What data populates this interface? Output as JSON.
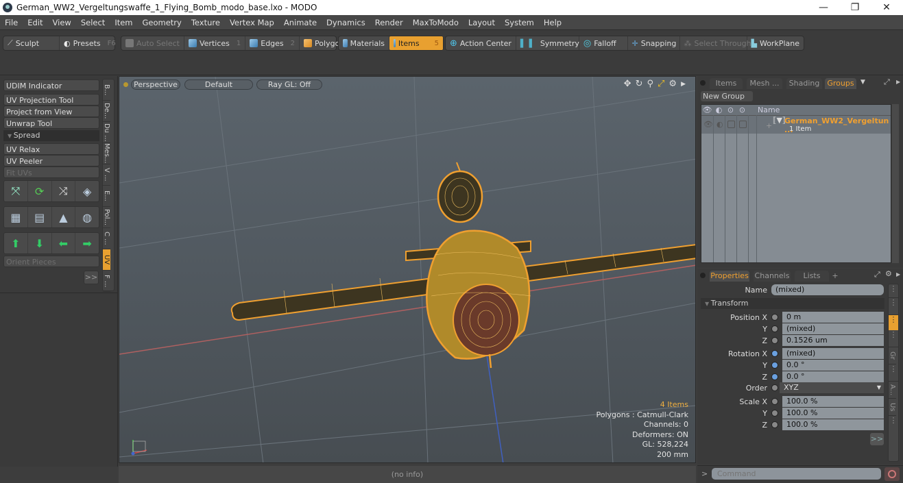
{
  "window": {
    "title": "German_WW2_Vergeltungswaffe_1_Flying_Bomb_modo_base.lxo - MODO",
    "minimize": "—",
    "restore": "❐",
    "close": "✕"
  },
  "menu": [
    "File",
    "Edit",
    "View",
    "Select",
    "Item",
    "Geometry",
    "Texture",
    "Vertex Map",
    "Animate",
    "Dynamics",
    "Render",
    "MaxToModo",
    "Layout",
    "System",
    "Help"
  ],
  "toolbar": {
    "sculpt": "Sculpt",
    "presets": "Presets",
    "presets_key": "F6",
    "auto_select": "Auto Select",
    "vertices": "Vertices",
    "vertices_key": "1",
    "edges": "Edges",
    "edges_key": "2",
    "polygons": "Polygons",
    "materials": "Materials",
    "items": "Items",
    "items_key": "5",
    "action_center": "Action Center",
    "symmetry": "Symmetry",
    "falloff": "Falloff",
    "snapping": "Snapping",
    "select_through": "Select Through",
    "workplane": "WorkPlane"
  },
  "left_panel": {
    "udim": "UDIM Indicator",
    "uv_projection": "UV Projection Tool",
    "project_from_view": "Project from View",
    "unwrap": "Unwrap Tool",
    "spread": "Spread",
    "uv_relax": "UV Relax",
    "uv_peeler": "UV Peeler",
    "fit_uvs": "Fit UVs",
    "orient_pieces": "Orient Pieces",
    "more": ">>",
    "vtabs": [
      "B...",
      "De...",
      "Du ...",
      "Mes...",
      "V ...",
      "E...",
      "Pol...",
      "C ...",
      "UV",
      "F ..."
    ]
  },
  "viewport": {
    "view": "Perspective",
    "shading": "Default",
    "raygl": "Ray GL: Off",
    "hud": {
      "items": "4 Items",
      "polygons": "Polygons : Catmull-Clark",
      "channels": "Channels: 0",
      "deformers": "Deformers: ON",
      "gl": "GL: 528,224",
      "scale": "200 mm"
    },
    "colors": {
      "wire": "#f0a030",
      "axis_x": "#c05050",
      "axis_z": "#4060c0"
    }
  },
  "status": "(no info)",
  "groups_panel": {
    "tabs": [
      "Items",
      "Mesh ...",
      "Shading",
      "Groups"
    ],
    "active_tab": "Groups",
    "new_group": "New Group",
    "col_name": "Name",
    "row_name": "German_WW2_Vergeltun ...",
    "row_sub": "1 Item"
  },
  "properties_panel": {
    "tabs": [
      "Properties",
      "Channels",
      "Lists",
      "+"
    ],
    "name_label": "Name",
    "name_value": "(mixed)",
    "transform": "Transform",
    "position": {
      "label_x": "Position X",
      "x": "0 m",
      "y": "(mixed)",
      "z": "0.1526 um"
    },
    "rotation": {
      "label_x": "Rotation X",
      "x": "(mixed)",
      "y": "0.0 °",
      "z": "0.0 °"
    },
    "order": {
      "label": "Order",
      "value": "XYZ"
    },
    "scale": {
      "label_x": "Scale X",
      "x": "100.0 %",
      "y": "100.0 %",
      "z": "100.0 %"
    },
    "axis_y": "Y",
    "axis_z": "Z",
    "more": ">>",
    "side_tabs": [
      "Gr",
      "A...",
      "Us"
    ]
  },
  "command": {
    "placeholder": "Command",
    "prompt": ">"
  }
}
